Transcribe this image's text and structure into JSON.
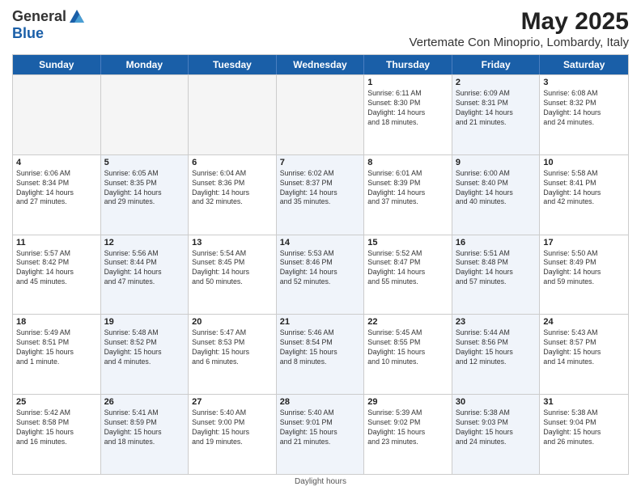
{
  "header": {
    "logo_general": "General",
    "logo_blue": "Blue",
    "main_title": "May 2025",
    "subtitle": "Vertemate Con Minoprio, Lombardy, Italy"
  },
  "calendar": {
    "days_of_week": [
      "Sunday",
      "Monday",
      "Tuesday",
      "Wednesday",
      "Thursday",
      "Friday",
      "Saturday"
    ],
    "weeks": [
      [
        {
          "day": "",
          "info": "",
          "empty": true
        },
        {
          "day": "",
          "info": "",
          "empty": true
        },
        {
          "day": "",
          "info": "",
          "empty": true
        },
        {
          "day": "",
          "info": "",
          "empty": true
        },
        {
          "day": "1",
          "info": "Sunrise: 6:11 AM\nSunset: 8:30 PM\nDaylight: 14 hours\nand 18 minutes."
        },
        {
          "day": "2",
          "info": "Sunrise: 6:09 AM\nSunset: 8:31 PM\nDaylight: 14 hours\nand 21 minutes."
        },
        {
          "day": "3",
          "info": "Sunrise: 6:08 AM\nSunset: 8:32 PM\nDaylight: 14 hours\nand 24 minutes."
        }
      ],
      [
        {
          "day": "4",
          "info": "Sunrise: 6:06 AM\nSunset: 8:34 PM\nDaylight: 14 hours\nand 27 minutes."
        },
        {
          "day": "5",
          "info": "Sunrise: 6:05 AM\nSunset: 8:35 PM\nDaylight: 14 hours\nand 29 minutes."
        },
        {
          "day": "6",
          "info": "Sunrise: 6:04 AM\nSunset: 8:36 PM\nDaylight: 14 hours\nand 32 minutes."
        },
        {
          "day": "7",
          "info": "Sunrise: 6:02 AM\nSunset: 8:37 PM\nDaylight: 14 hours\nand 35 minutes."
        },
        {
          "day": "8",
          "info": "Sunrise: 6:01 AM\nSunset: 8:39 PM\nDaylight: 14 hours\nand 37 minutes."
        },
        {
          "day": "9",
          "info": "Sunrise: 6:00 AM\nSunset: 8:40 PM\nDaylight: 14 hours\nand 40 minutes."
        },
        {
          "day": "10",
          "info": "Sunrise: 5:58 AM\nSunset: 8:41 PM\nDaylight: 14 hours\nand 42 minutes."
        }
      ],
      [
        {
          "day": "11",
          "info": "Sunrise: 5:57 AM\nSunset: 8:42 PM\nDaylight: 14 hours\nand 45 minutes."
        },
        {
          "day": "12",
          "info": "Sunrise: 5:56 AM\nSunset: 8:44 PM\nDaylight: 14 hours\nand 47 minutes."
        },
        {
          "day": "13",
          "info": "Sunrise: 5:54 AM\nSunset: 8:45 PM\nDaylight: 14 hours\nand 50 minutes."
        },
        {
          "day": "14",
          "info": "Sunrise: 5:53 AM\nSunset: 8:46 PM\nDaylight: 14 hours\nand 52 minutes."
        },
        {
          "day": "15",
          "info": "Sunrise: 5:52 AM\nSunset: 8:47 PM\nDaylight: 14 hours\nand 55 minutes."
        },
        {
          "day": "16",
          "info": "Sunrise: 5:51 AM\nSunset: 8:48 PM\nDaylight: 14 hours\nand 57 minutes."
        },
        {
          "day": "17",
          "info": "Sunrise: 5:50 AM\nSunset: 8:49 PM\nDaylight: 14 hours\nand 59 minutes."
        }
      ],
      [
        {
          "day": "18",
          "info": "Sunrise: 5:49 AM\nSunset: 8:51 PM\nDaylight: 15 hours\nand 1 minute."
        },
        {
          "day": "19",
          "info": "Sunrise: 5:48 AM\nSunset: 8:52 PM\nDaylight: 15 hours\nand 4 minutes."
        },
        {
          "day": "20",
          "info": "Sunrise: 5:47 AM\nSunset: 8:53 PM\nDaylight: 15 hours\nand 6 minutes."
        },
        {
          "day": "21",
          "info": "Sunrise: 5:46 AM\nSunset: 8:54 PM\nDaylight: 15 hours\nand 8 minutes."
        },
        {
          "day": "22",
          "info": "Sunrise: 5:45 AM\nSunset: 8:55 PM\nDaylight: 15 hours\nand 10 minutes."
        },
        {
          "day": "23",
          "info": "Sunrise: 5:44 AM\nSunset: 8:56 PM\nDaylight: 15 hours\nand 12 minutes."
        },
        {
          "day": "24",
          "info": "Sunrise: 5:43 AM\nSunset: 8:57 PM\nDaylight: 15 hours\nand 14 minutes."
        }
      ],
      [
        {
          "day": "25",
          "info": "Sunrise: 5:42 AM\nSunset: 8:58 PM\nDaylight: 15 hours\nand 16 minutes."
        },
        {
          "day": "26",
          "info": "Sunrise: 5:41 AM\nSunset: 8:59 PM\nDaylight: 15 hours\nand 18 minutes."
        },
        {
          "day": "27",
          "info": "Sunrise: 5:40 AM\nSunset: 9:00 PM\nDaylight: 15 hours\nand 19 minutes."
        },
        {
          "day": "28",
          "info": "Sunrise: 5:40 AM\nSunset: 9:01 PM\nDaylight: 15 hours\nand 21 minutes."
        },
        {
          "day": "29",
          "info": "Sunrise: 5:39 AM\nSunset: 9:02 PM\nDaylight: 15 hours\nand 23 minutes."
        },
        {
          "day": "30",
          "info": "Sunrise: 5:38 AM\nSunset: 9:03 PM\nDaylight: 15 hours\nand 24 minutes."
        },
        {
          "day": "31",
          "info": "Sunrise: 5:38 AM\nSunset: 9:04 PM\nDaylight: 15 hours\nand 26 minutes."
        }
      ]
    ]
  },
  "footer": {
    "note": "Daylight hours"
  }
}
